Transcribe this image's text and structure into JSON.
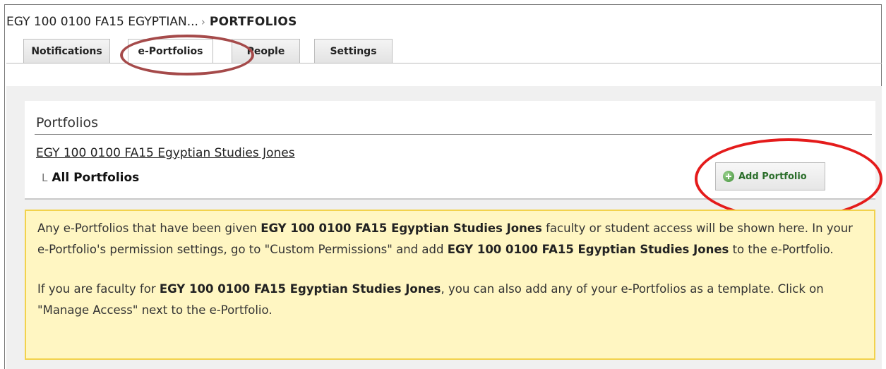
{
  "breadcrumb": {
    "course": "EGY 100 0100 FA15 EGYPTIAN...",
    "separator": "›",
    "current": "PORTFOLIOS"
  },
  "tabs": [
    {
      "label": "Notifications",
      "active": false
    },
    {
      "label": "e-Portfolios",
      "active": true
    },
    {
      "label": "People",
      "active": false
    },
    {
      "label": "Settings",
      "active": false
    }
  ],
  "panel": {
    "title": "Portfolios",
    "course_link": "EGY 100 0100 FA15 Egyptian Studies Jones",
    "tree_marker": "L",
    "all_portfolios": "All Portfolios"
  },
  "add_button": {
    "label": "Add Portfolio",
    "icon": "plus-circle-icon",
    "color": "#2b6e2b"
  },
  "notice": {
    "p1_a": "Any e-Portfolios that have been given ",
    "p1_b": "EGY 100 0100 FA15 Egyptian Studies Jones",
    "p1_c": " faculty or student access will be shown here. In your e-Portfolio's permission settings, go to \"Custom Permissions\" and add ",
    "p1_d": "EGY 100 0100 FA15 Egyptian Studies Jones",
    "p1_e": " to the e-Portfolio.",
    "p2_a": "If you are faculty for ",
    "p2_b": "EGY 100 0100 FA15 Egyptian Studies Jones",
    "p2_c": ", you can also add any of your e-Portfolios as a template. Click on \"Manage Access\" next to the e-Portfolio."
  },
  "colors": {
    "notice_bg": "#fff6c2",
    "notice_border": "#f2d24c",
    "tab_highlight_circle": "#a54a4a",
    "button_highlight_circle": "#e41b1b"
  }
}
